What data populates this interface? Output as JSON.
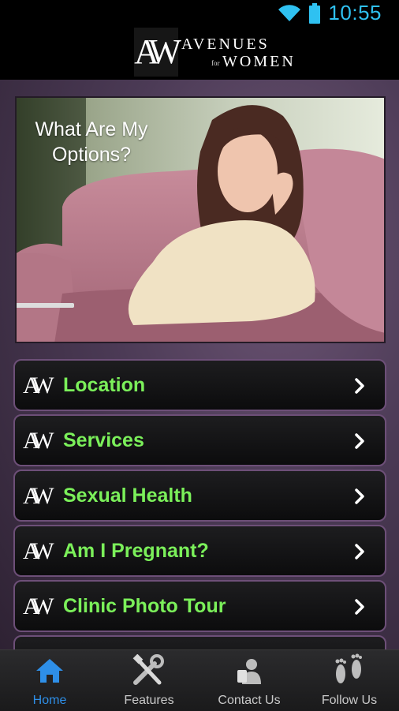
{
  "status_bar": {
    "time": "10:55"
  },
  "header": {
    "logo_mark": "AW",
    "logo_top": "AVENUES",
    "logo_for": "for",
    "logo_bottom": "WOMEN"
  },
  "hero": {
    "title": "What Are My Options?"
  },
  "menu": {
    "items": [
      {
        "label": "Location"
      },
      {
        "label": "Services"
      },
      {
        "label": "Sexual Health"
      },
      {
        "label": "Am I Pregnant?"
      },
      {
        "label": "Clinic Photo Tour"
      }
    ],
    "item_logo": "AW"
  },
  "tabs": [
    {
      "label": "Home",
      "icon": "home-icon",
      "active": true
    },
    {
      "label": "Features",
      "icon": "tools-icon",
      "active": false
    },
    {
      "label": "Contact Us",
      "icon": "contact-icon",
      "active": false
    },
    {
      "label": "Follow Us",
      "icon": "footprints-icon",
      "active": false
    }
  ],
  "colors": {
    "accent_time": "#2fc1f1",
    "menu_label": "#7bf05a",
    "menu_border": "#6d4f78",
    "tab_active": "#2e8fe8"
  }
}
